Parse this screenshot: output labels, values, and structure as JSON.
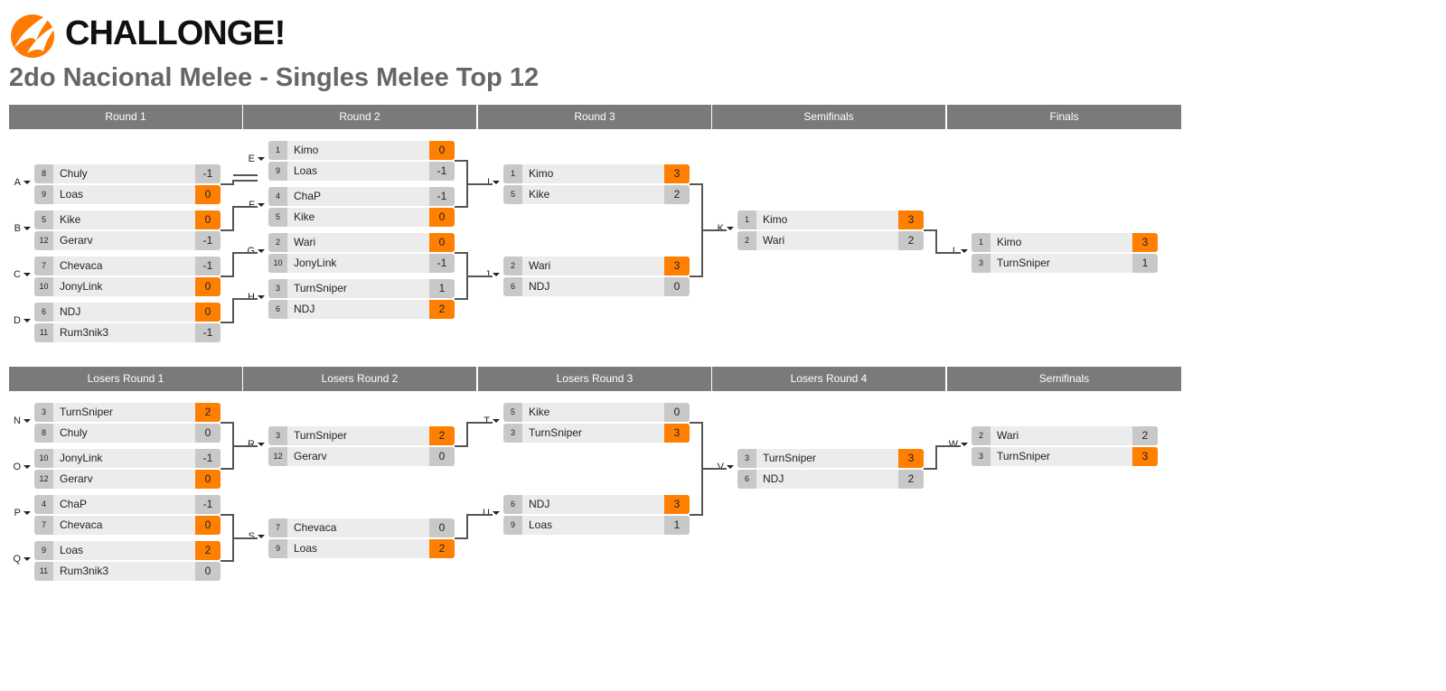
{
  "brand": "CHALLONGE!",
  "title": "2do Nacional Melee - Singles Melee Top 12",
  "colors": {
    "accent": "#ff7f00",
    "header": "#7a7a7a",
    "row": "#ececec",
    "seed": "#c8c8c8"
  },
  "winners": {
    "rounds": [
      "Round 1",
      "Round 2",
      "Round 3",
      "Semifinals",
      "Finals"
    ],
    "matches": [
      {
        "id": "A",
        "players": [
          {
            "seed": "8",
            "name": "Chuly",
            "score": "-1"
          },
          {
            "seed": "9",
            "name": "Loas",
            "score": "0",
            "win": true
          }
        ]
      },
      {
        "id": "B",
        "players": [
          {
            "seed": "5",
            "name": "Kike",
            "score": "0",
            "win": true
          },
          {
            "seed": "12",
            "name": "Gerarv",
            "score": "-1"
          }
        ]
      },
      {
        "id": "C",
        "players": [
          {
            "seed": "7",
            "name": "Chevaca",
            "score": "-1"
          },
          {
            "seed": "10",
            "name": "JonyLink",
            "score": "0",
            "win": true
          }
        ]
      },
      {
        "id": "D",
        "players": [
          {
            "seed": "6",
            "name": "NDJ",
            "score": "0",
            "win": true
          },
          {
            "seed": "11",
            "name": "Rum3nik3",
            "score": "-1"
          }
        ]
      },
      {
        "id": "E",
        "players": [
          {
            "seed": "1",
            "name": "Kimo",
            "score": "0",
            "win": true
          },
          {
            "seed": "9",
            "name": "Loas",
            "score": "-1"
          }
        ]
      },
      {
        "id": "F",
        "players": [
          {
            "seed": "4",
            "name": "ChaP",
            "score": "-1"
          },
          {
            "seed": "5",
            "name": "Kike",
            "score": "0",
            "win": true
          }
        ]
      },
      {
        "id": "G",
        "players": [
          {
            "seed": "2",
            "name": "Wari",
            "score": "0",
            "win": true
          },
          {
            "seed": "10",
            "name": "JonyLink",
            "score": "-1"
          }
        ]
      },
      {
        "id": "H",
        "players": [
          {
            "seed": "3",
            "name": "TurnSniper",
            "score": "1"
          },
          {
            "seed": "6",
            "name": "NDJ",
            "score": "2",
            "win": true
          }
        ]
      },
      {
        "id": "I",
        "players": [
          {
            "seed": "1",
            "name": "Kimo",
            "score": "3",
            "win": true
          },
          {
            "seed": "5",
            "name": "Kike",
            "score": "2"
          }
        ]
      },
      {
        "id": "J",
        "players": [
          {
            "seed": "2",
            "name": "Wari",
            "score": "3",
            "win": true
          },
          {
            "seed": "6",
            "name": "NDJ",
            "score": "0"
          }
        ]
      },
      {
        "id": "K",
        "players": [
          {
            "seed": "1",
            "name": "Kimo",
            "score": "3",
            "win": true
          },
          {
            "seed": "2",
            "name": "Wari",
            "score": "2"
          }
        ]
      },
      {
        "id": "L",
        "players": [
          {
            "seed": "1",
            "name": "Kimo",
            "score": "3",
            "win": true
          },
          {
            "seed": "3",
            "name": "TurnSniper",
            "score": "1"
          }
        ]
      }
    ]
  },
  "losers": {
    "rounds": [
      "Losers Round 1",
      "Losers Round 2",
      "Losers Round 3",
      "Losers Round 4",
      "Semifinals"
    ],
    "matches": [
      {
        "id": "N",
        "players": [
          {
            "seed": "3",
            "name": "TurnSniper",
            "score": "2",
            "win": true
          },
          {
            "seed": "8",
            "name": "Chuly",
            "score": "0"
          }
        ]
      },
      {
        "id": "O",
        "players": [
          {
            "seed": "10",
            "name": "JonyLink",
            "score": "-1"
          },
          {
            "seed": "12",
            "name": "Gerarv",
            "score": "0",
            "win": true
          }
        ]
      },
      {
        "id": "P",
        "players": [
          {
            "seed": "4",
            "name": "ChaP",
            "score": "-1"
          },
          {
            "seed": "7",
            "name": "Chevaca",
            "score": "0",
            "win": true
          }
        ]
      },
      {
        "id": "Q",
        "players": [
          {
            "seed": "9",
            "name": "Loas",
            "score": "2",
            "win": true
          },
          {
            "seed": "11",
            "name": "Rum3nik3",
            "score": "0"
          }
        ]
      },
      {
        "id": "R",
        "players": [
          {
            "seed": "3",
            "name": "TurnSniper",
            "score": "2",
            "win": true
          },
          {
            "seed": "12",
            "name": "Gerarv",
            "score": "0"
          }
        ]
      },
      {
        "id": "S",
        "players": [
          {
            "seed": "7",
            "name": "Chevaca",
            "score": "0"
          },
          {
            "seed": "9",
            "name": "Loas",
            "score": "2",
            "win": true
          }
        ]
      },
      {
        "id": "T",
        "players": [
          {
            "seed": "5",
            "name": "Kike",
            "score": "0"
          },
          {
            "seed": "3",
            "name": "TurnSniper",
            "score": "3",
            "win": true
          }
        ]
      },
      {
        "id": "U",
        "players": [
          {
            "seed": "6",
            "name": "NDJ",
            "score": "3",
            "win": true
          },
          {
            "seed": "9",
            "name": "Loas",
            "score": "1"
          }
        ]
      },
      {
        "id": "V",
        "players": [
          {
            "seed": "3",
            "name": "TurnSniper",
            "score": "3",
            "win": true
          },
          {
            "seed": "6",
            "name": "NDJ",
            "score": "2"
          }
        ]
      },
      {
        "id": "W",
        "players": [
          {
            "seed": "2",
            "name": "Wari",
            "score": "2"
          },
          {
            "seed": "3",
            "name": "TurnSniper",
            "score": "3",
            "win": true
          }
        ]
      }
    ]
  }
}
